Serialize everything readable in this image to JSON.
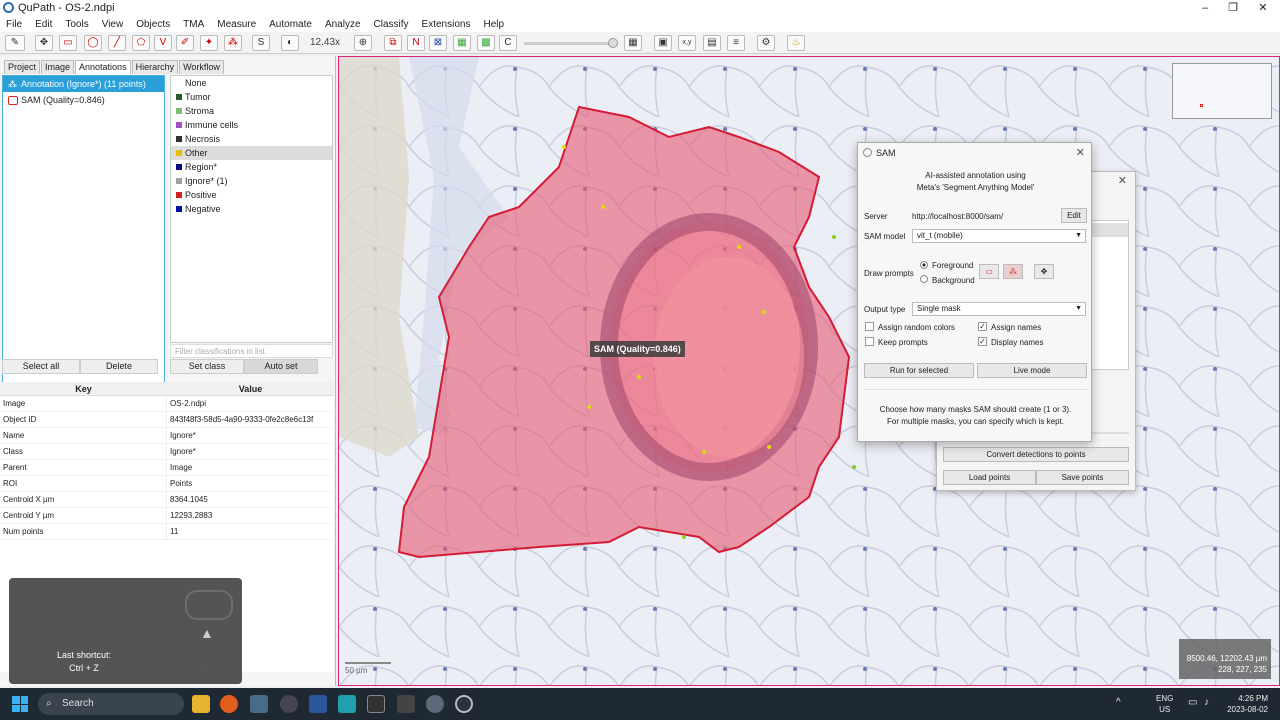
{
  "window": {
    "title": "QuPath - OS-2.ndpi"
  },
  "menu": [
    "File",
    "Edit",
    "Tools",
    "View",
    "Objects",
    "TMA",
    "Measure",
    "Automate",
    "Analyze",
    "Classify",
    "Extensions",
    "Help"
  ],
  "toolbar": {
    "zoom": "12.43x"
  },
  "tabs": [
    "Project",
    "Image",
    "Annotations",
    "Hierarchy",
    "Workflow"
  ],
  "annotations": [
    {
      "label": "Annotation (Ignore*) (11 points)"
    },
    {
      "label": "SAM (Quality=0.846)"
    }
  ],
  "classes": [
    {
      "name": "None",
      "color": "#ffffff"
    },
    {
      "name": "Tumor",
      "color": "#2a5a2a"
    },
    {
      "name": "Stroma",
      "color": "#7ac070"
    },
    {
      "name": "Immune cells",
      "color": "#a050c0"
    },
    {
      "name": "Necrosis",
      "color": "#333333"
    },
    {
      "name": "Other",
      "color": "#e0c000"
    },
    {
      "name": "Region*",
      "color": "#0a0a80"
    },
    {
      "name": "Ignore* (1)",
      "color": "#a0a0a0"
    },
    {
      "name": "Positive",
      "color": "#d02020"
    },
    {
      "name": "Negative",
      "color": "#0010a0"
    }
  ],
  "class_filter_placeholder": "Filter classifications in list",
  "buttons": {
    "select_all": "Select all",
    "delete": "Delete",
    "set_class": "Set class",
    "auto_set": "Auto set"
  },
  "properties": {
    "headers": [
      "Key",
      "Value"
    ],
    "rows": [
      [
        "Image",
        "OS-2.ndpi"
      ],
      [
        "Object ID",
        "843f48f3-58d5-4a90-9333-0fe2c8e6c13f"
      ],
      [
        "Name",
        "Ignore*"
      ],
      [
        "Class",
        "Ignore*"
      ],
      [
        "Parent",
        "Image"
      ],
      [
        "ROI",
        "Points"
      ],
      [
        "Centroid X µm",
        "8364.1045"
      ],
      [
        "Centroid Y µm",
        "12293.2883"
      ],
      [
        "Num points",
        "11"
      ]
    ]
  },
  "shortcut": {
    "line1": "Last shortcut:",
    "line2": "Ctrl + Z"
  },
  "viewer": {
    "overlay_label": "SAM (Quality=0.846)",
    "scale": "50 µm",
    "coords1": "8500.46, 12202.43 µm",
    "coords2": "228, 227, 235"
  },
  "bg_dialog": {
    "convert": "Convert detections to points",
    "load": "Load points",
    "save": "Save points"
  },
  "sam": {
    "title": "SAM",
    "intro1": "AI-assisted annotation using",
    "intro2": "Meta's 'Segment Anything Model'",
    "server_label": "Server",
    "server_url": "http://localhost:8000/sam/",
    "edit": "Edit",
    "model_label": "SAM model",
    "model_value": "vit_t (mobile)",
    "draw_label": "Draw prompts",
    "foreground": "Foreground",
    "background": "Background",
    "output_label": "Output type",
    "output_value": "Single mask",
    "assign_random": "Assign random colors",
    "assign_names": "Assign names",
    "keep_prompts": "Keep prompts",
    "display_names": "Display names",
    "run_selected": "Run for selected",
    "live_mode": "Live mode",
    "info1": "Choose how many masks SAM should create (1 or 3).",
    "info2": "For multiple masks, you can specify which is kept."
  },
  "taskbar": {
    "search": "Search",
    "lang1": "ENG",
    "lang2": "US",
    "time": "4:26 PM",
    "date": "2023-08-02"
  }
}
